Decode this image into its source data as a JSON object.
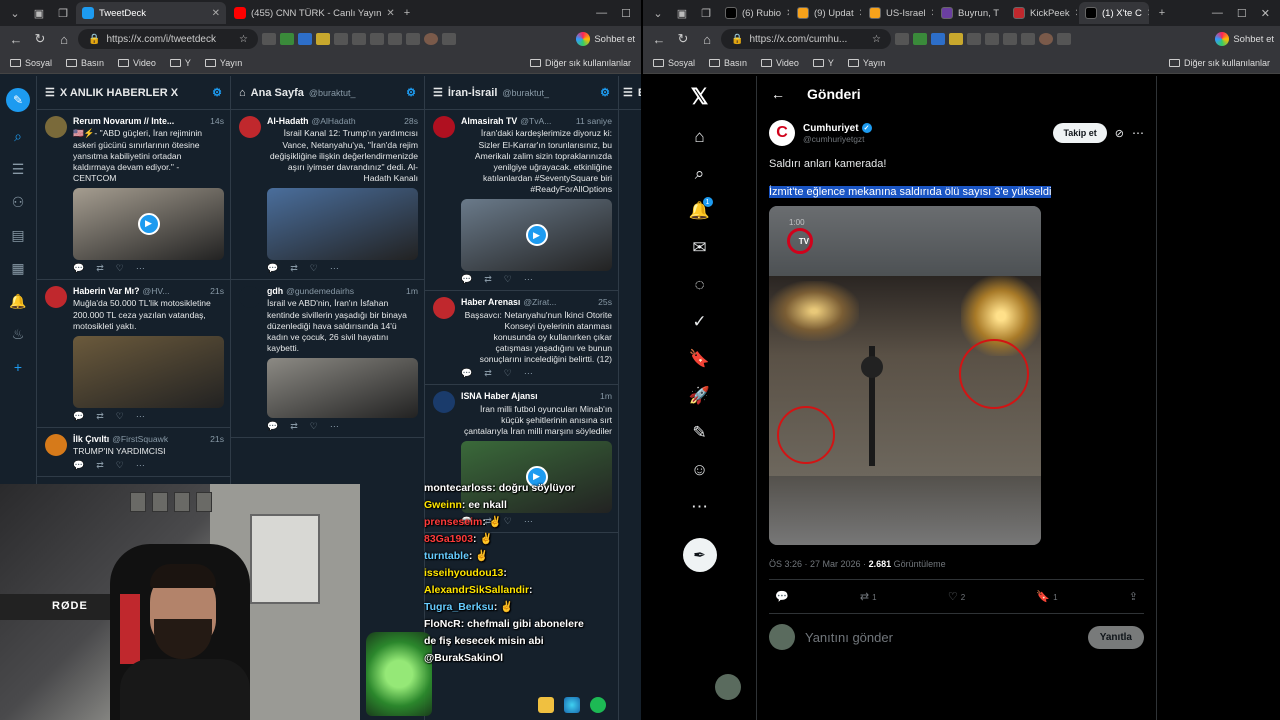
{
  "left_browser": {
    "tabs": [
      {
        "label": "TweetDeck",
        "active": true,
        "color": "#1d9bf0"
      },
      {
        "label": "(455) CNN TÜRK - Canlı Yayın",
        "active": false,
        "color": "#ff0000"
      }
    ],
    "url": "https://x.com/i/tweetdeck",
    "sohbet": "Sohbet et",
    "bookmarks": [
      "Sosyal",
      "Basın",
      "Video",
      "Y",
      "Yayın"
    ],
    "bookmarks_right": "Diğer sık kullanılanlar"
  },
  "right_browser": {
    "tabs": [
      {
        "label": "(6) Rubio",
        "color": "#000000"
      },
      {
        "label": "(9) Updat",
        "color": "#f7a21b"
      },
      {
        "label": "US-Israel",
        "color": "#f7a21b"
      },
      {
        "label": "Buyrun, T",
        "color": "#6b3fa0"
      },
      {
        "label": "KickPeek",
        "color": "#c0282d"
      },
      {
        "label": "(1) X'te C",
        "color": "#000000"
      }
    ],
    "url": "https://x.com/cumhu...",
    "sohbet": "Sohbet et",
    "bookmarks": [
      "Sosyal",
      "Basın",
      "Video",
      "Y",
      "Yayın"
    ],
    "bookmarks_right": "Diğer sık kullanılanlar"
  },
  "tweetdeck": {
    "columns": [
      {
        "title": "X ANLIK HABERLER X",
        "subtitle": "",
        "tweets": [
          {
            "name": "Rerum Novarum // Inte...",
            "handle": "",
            "time": "14s",
            "text": "🇺🇸⚡- \"ABD güçleri, İran rejiminin askeri gücünü sınırlarının ötesine yansıtma kabiliyetini ortadan kaldırmaya devam ediyor.\" - CENTCOM",
            "avatar": "#7a6a3a",
            "media": "video",
            "media_color": "#a59d90",
            "media_h": 72,
            "rtl": false
          },
          {
            "name": "Haberin Var Mı?",
            "handle": "@HV...",
            "time": "21s",
            "text": "Muğla'da 50.000 TL'lik motosikletine 200.000 TL ceza yazılan vatandaş, motosikleti yaktı.",
            "avatar": "#c0282d",
            "media": "image",
            "media_color": "#6b5a3c",
            "media_h": 72,
            "rtl": false
          },
          {
            "name": "İlk Çıvıltı",
            "handle": "@FirstSquawk",
            "time": "21s",
            "text": "TRUMP'IN YARDIMCISI",
            "avatar": "#d67a1a",
            "media": "",
            "media_color": "",
            "media_h": 0,
            "rtl": false
          }
        ]
      },
      {
        "title": "Ana Sayfa",
        "subtitle": "@buraktut_",
        "tweets": [
          {
            "name": "Al-Hadath",
            "handle": "@AlHadath",
            "time": "28s",
            "text": "İsrail Kanal 12: Trump'ın yardımcısı Vance, Netanyahu'ya, \"İran'da rejim değişikliğine ilişkin değerlendirmenizde aşırı iyimser davrandınız\" dedi. Al-Hadath Kanalı",
            "avatar": "#c0282d",
            "media": "image",
            "media_color": "#4a6e9c",
            "media_h": 72,
            "rtl": true
          },
          {
            "name": "gdh",
            "handle": "@gundemedairhs",
            "time": "1m",
            "text": "İsrail ve ABD'nin, İran'ın İsfahan kentinde sivillerin yaşadığı bir binaya düzenlediği hava saldırısında 14'ü kadın ve çocuk, 26 sivil hayatını kaybetti.",
            "avatar": "#15202b",
            "media": "image",
            "media_color": "#8c8a84",
            "media_h": 60,
            "rtl": false
          }
        ]
      },
      {
        "title": "İran-İsrail",
        "subtitle": "@buraktut_",
        "tweets": [
          {
            "name": "Almasirah TV",
            "handle": "@TvA...",
            "time": "11 saniye",
            "text": "İran'daki kardeşlerimize diyoruz ki: Sizler El-Karrar'ın torunlarısınız, bu Amerikalı zalim sizin topraklarınızda yenilgiye uğrayacak. etkinliğine katılanlardan #SeventySquare biri #ReadyForAllOptions",
            "avatar": "#b01020",
            "media": "video",
            "media_color": "#6a7a8a",
            "media_h": 72,
            "rtl": true
          },
          {
            "name": "Haber Arenası",
            "handle": "@Zirat...",
            "time": "25s",
            "text": "Başsavcı: Netanyahu'nun İkinci Otorite Konseyi üyelerinin atanması konusunda oy kullanırken çıkar çatışması yaşadığını ve bunun sonuçlarını incelediğini belirtti. (12)",
            "avatar": "#c0282d",
            "media": "",
            "media_color": "",
            "media_h": 0,
            "rtl": true
          },
          {
            "name": "ISNA Haber Ajansı",
            "handle": "",
            "time": "1m",
            "text": "İran milli futbol oyuncuları Minab'ın küçük şehitlerinin anısına sırt çantalarıyla İran milli marşını söylediler",
            "avatar": "#1a3b6b",
            "media": "video",
            "media_color": "#3a6a3a",
            "media_h": 72,
            "rtl": true
          }
        ]
      }
    ],
    "partial_column_title": "El"
  },
  "stream_chat": [
    {
      "user": "montecarloss",
      "msg": ": doğru söylüyor",
      "user_color": "#ffffff"
    },
    {
      "user": "Gweinn",
      "msg": ": ee nkall",
      "user_color": "#ffe500"
    },
    {
      "user": "prenseseim",
      "msg": ": ✌",
      "user_color": "#ff3b3b"
    },
    {
      "user": "83Ga1903",
      "msg": ": ✌",
      "user_color": "#ff3b3b"
    },
    {
      "user": "turntable",
      "msg": ": ✌",
      "user_color": "#6cf"
    },
    {
      "user": "isseihyoudou13",
      "msg": ":",
      "user_color": "#ffe500"
    },
    {
      "user": "AlexandrSikSallandir",
      "msg": ":",
      "user_color": "#ffe500"
    },
    {
      "user": "Tugra_Berksu",
      "msg": ": ✌",
      "user_color": "#6cf"
    },
    {
      "user": "FloNcR",
      "msg": ": chefmali gibi abonelere",
      "user_color": "#ffffff"
    },
    {
      "user": "",
      "msg": "de fiş kesecek misin abi",
      "user_color": "#ffffff"
    },
    {
      "user": "",
      "msg": "@BurakSakinOl",
      "user_color": "#ffffff"
    }
  ],
  "cam": {
    "mic_label": "RØDE"
  },
  "x": {
    "header": "Gönderi",
    "author_name": "Cumhuriyet",
    "author_handle": "@cumhuriyetgzt",
    "follow_label": "Takip et",
    "post_text": "Saldırı anları kamerada!",
    "post_text_selected": "İzmit'te eğlence mekanına saldırıda ölü sayısı 3'e yükseldi",
    "video_timestamp": "1:00",
    "video_logo": "TV",
    "meta_time": "ÖS 3:26 · 27 Mar 2026 · ",
    "meta_views_count": "2.681",
    "meta_views_label": " Görüntüleme",
    "stats": {
      "retweets": "1",
      "likes": "2",
      "bookmarks": "1"
    },
    "reply_placeholder": "Yanıtını gönder",
    "reply_button": "Yanıtla",
    "notifications_badge": "1"
  }
}
